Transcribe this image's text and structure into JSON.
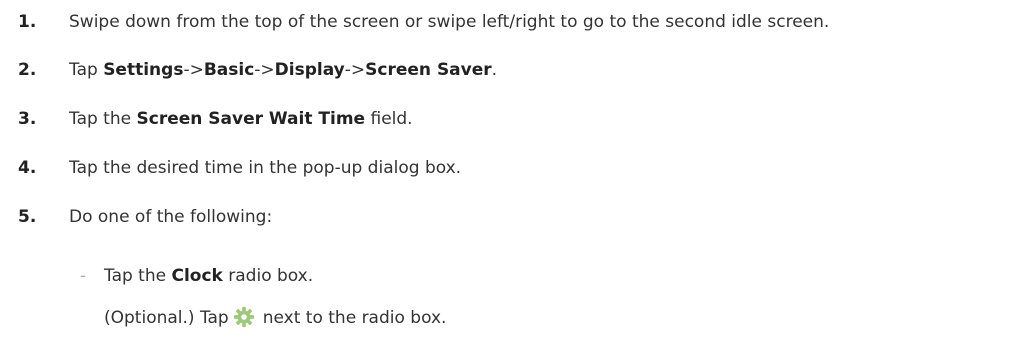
{
  "steps": [
    {
      "number": "1.",
      "text": "Swipe down from the top of the screen or swipe left/right to go to the second idle screen."
    },
    {
      "number": "2.",
      "pre": "Tap ",
      "b1": "Settings",
      "sep1": "->",
      "b2": "Basic",
      "sep2": "->",
      "b3": "Display",
      "sep3": "->",
      "b4": "Screen Saver",
      "post": "."
    },
    {
      "number": "3.",
      "pre": "Tap the ",
      "bold": "Screen Saver Wait Time",
      "post": " field."
    },
    {
      "number": "4.",
      "text": "Tap the desired time in the pop-up dialog box."
    },
    {
      "number": "5.",
      "text": "Do one of the following:"
    }
  ],
  "substeps": {
    "dash": "-",
    "clock": {
      "pre": "Tap the ",
      "bold": "Clock",
      "post": " radio box."
    },
    "optional": {
      "pre": "(Optional.) Tap",
      "post": "next to the radio box."
    }
  },
  "icons": {
    "settings_gear": "gear-icon",
    "gear_color": "#9fc97a"
  }
}
